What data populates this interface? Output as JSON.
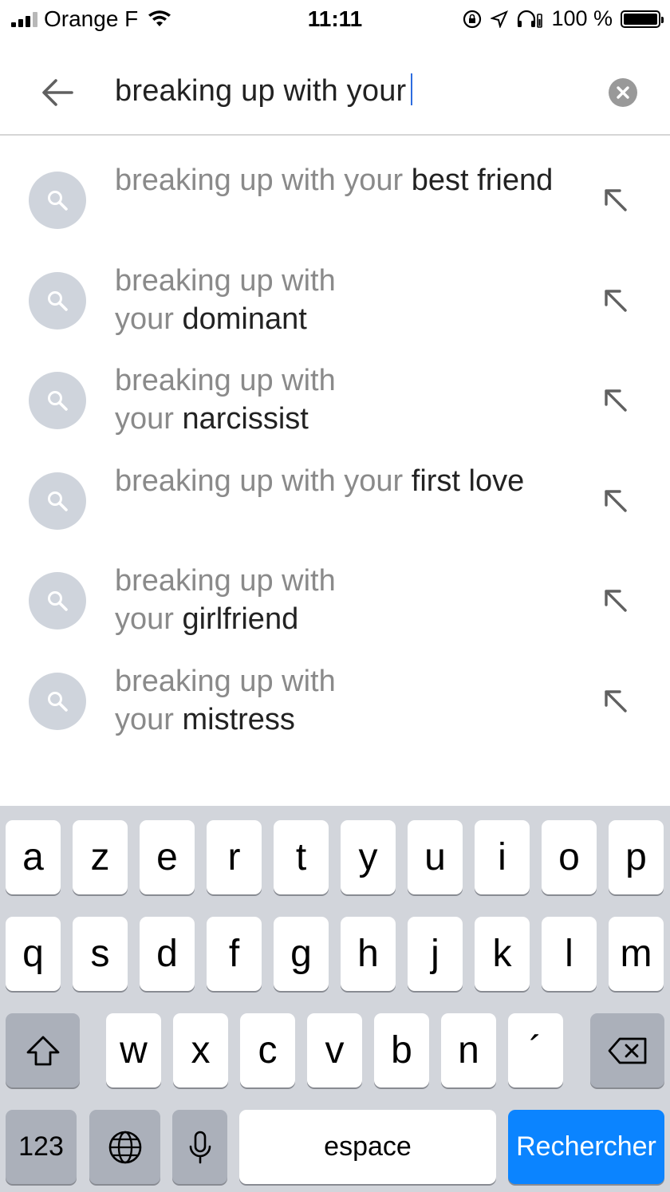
{
  "status_bar": {
    "carrier": "Orange F",
    "time": "11:11",
    "battery": "100 %"
  },
  "search": {
    "query": "breaking up with your"
  },
  "suggestions": [
    {
      "typed": "breaking up with your",
      "completion": "best friend"
    },
    {
      "typed": "breaking up with your",
      "completion": "dominant"
    },
    {
      "typed": "breaking up with your",
      "completion": "narcissist"
    },
    {
      "typed": "breaking up with your",
      "completion": "first love"
    },
    {
      "typed": "breaking up with your",
      "completion": "girlfriend"
    },
    {
      "typed": "breaking up with your",
      "completion": "mistress"
    }
  ],
  "keyboard": {
    "row1": [
      "a",
      "z",
      "e",
      "r",
      "t",
      "y",
      "u",
      "i",
      "o",
      "p"
    ],
    "row2": [
      "q",
      "s",
      "d",
      "f",
      "g",
      "h",
      "j",
      "k",
      "l",
      "m"
    ],
    "row3": [
      "w",
      "x",
      "c",
      "v",
      "b",
      "n",
      "´"
    ],
    "numbers_label": "123",
    "space_label": "espace",
    "return_label": "Rechercher"
  },
  "colors": {
    "accent": "#0b84ff",
    "suggestion_icon_bg": "#cfd4dc",
    "keyboard_bg": "#d2d5db"
  }
}
